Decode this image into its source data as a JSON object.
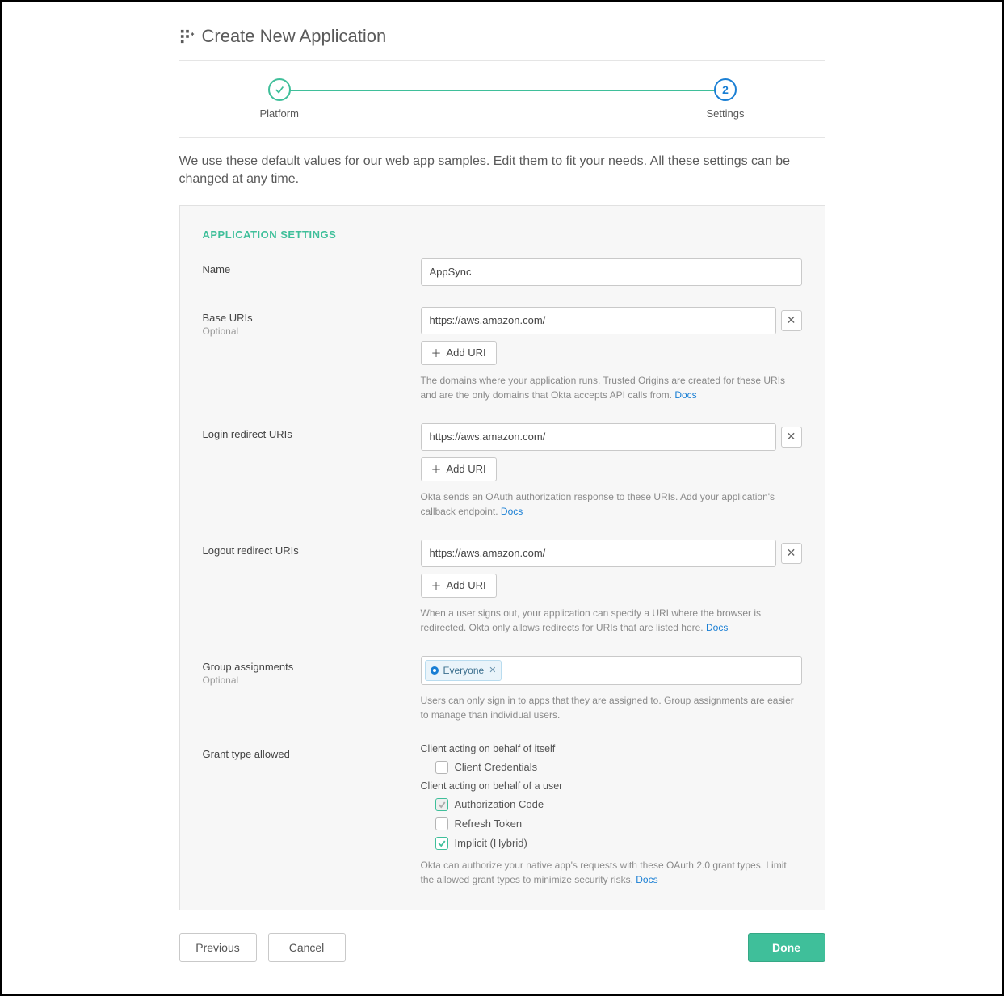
{
  "header": {
    "title": "Create New Application"
  },
  "stepper": {
    "steps": [
      {
        "label": "Platform",
        "state": "done",
        "indicator": "✓"
      },
      {
        "label": "Settings",
        "state": "active",
        "indicator": "2"
      }
    ]
  },
  "intro": "We use these default values for our web app samples. Edit them to fit your needs. All these settings can be changed at any time.",
  "section_heading": "APPLICATION SETTINGS",
  "fields": {
    "name": {
      "label": "Name",
      "value": "AppSync"
    },
    "base_uris": {
      "label": "Base URIs",
      "sublabel": "Optional",
      "values": [
        "https://aws.amazon.com/"
      ],
      "add_label": "Add URI",
      "helper_text": "The domains where your application runs. Trusted Origins are created for these URIs and are the only domains that Okta accepts API calls from. ",
      "docs_label": "Docs"
    },
    "login_uris": {
      "label": "Login redirect URIs",
      "values": [
        "https://aws.amazon.com/"
      ],
      "add_label": "Add URI",
      "helper_text": "Okta sends an OAuth authorization response to these URIs. Add your application's callback endpoint. ",
      "docs_label": "Docs"
    },
    "logout_uris": {
      "label": "Logout redirect URIs",
      "values": [
        "https://aws.amazon.com/"
      ],
      "add_label": "Add URI",
      "helper_text": "When a user signs out, your application can specify a URI where the browser is redirected. Okta only allows redirects for URIs that are listed here. ",
      "docs_label": "Docs"
    },
    "group_assignments": {
      "label": "Group assignments",
      "sublabel": "Optional",
      "tags": [
        "Everyone"
      ],
      "helper_text": "Users can only sign in to apps that they are assigned to. Group assignments are easier to manage than individual users."
    },
    "grant_type": {
      "label": "Grant type allowed",
      "group1_title": "Client acting on behalf of itself",
      "group1_options": [
        {
          "label": "Client Credentials",
          "checked": false,
          "disabled": false
        }
      ],
      "group2_title": "Client acting on behalf of a user",
      "group2_options": [
        {
          "label": "Authorization Code",
          "checked": true,
          "disabled": true
        },
        {
          "label": "Refresh Token",
          "checked": false,
          "disabled": false
        },
        {
          "label": "Implicit (Hybrid)",
          "checked": true,
          "disabled": false
        }
      ],
      "helper_text": "Okta can authorize your native app's requests with these OAuth 2.0 grant types. Limit the allowed grant types to minimize security risks. ",
      "docs_label": "Docs"
    }
  },
  "footer": {
    "previous": "Previous",
    "cancel": "Cancel",
    "done": "Done"
  }
}
